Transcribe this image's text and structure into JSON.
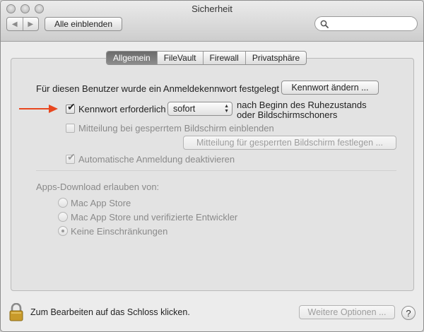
{
  "window": {
    "title": "Sicherheit"
  },
  "toolbar": {
    "back_glyph": "◀",
    "forward_glyph": "▶",
    "show_all_label": "Alle einblenden",
    "search": {
      "value": "",
      "placeholder": ""
    }
  },
  "tabs": [
    {
      "label": "Allgemein",
      "active": true
    },
    {
      "label": "FileVault",
      "active": false
    },
    {
      "label": "Firewall",
      "active": false
    },
    {
      "label": "Privatsphäre",
      "active": false
    }
  ],
  "general": {
    "password_info": "Für diesen Benutzer wurde ein Anmeldekennwort festgelegt",
    "change_password_button": "Kennwort ändern ...",
    "require_password": {
      "label": "Kennwort erforderlich",
      "checked": true
    },
    "require_delay_select": "sofort",
    "require_after_line1": "nach Beginn des Ruhezustands",
    "require_after_line2": "oder Bildschirmschoners",
    "lock_message": {
      "label": "Mitteilung bei gesperrtem Bildschirm einblenden",
      "checked": false,
      "enabled": false
    },
    "set_lock_message_button": "Mitteilung für gesperrten Bildschirm festlegen ...",
    "disable_auto_login": {
      "label": "Automatische Anmeldung deaktivieren",
      "checked": true,
      "enabled": false
    },
    "apps_download_label": "Apps-Download erlauben von:",
    "download_options": [
      {
        "label": "Mac App Store",
        "selected": false
      },
      {
        "label": "Mac App Store und verifizierte Entwickler",
        "selected": false
      },
      {
        "label": "Keine Einschränkungen",
        "selected": true
      }
    ]
  },
  "footer": {
    "lock_text": "Zum Bearbeiten auf das Schloss klicken.",
    "more_options_button": "Weitere Optionen ...",
    "help_label": "?"
  },
  "colors": {
    "annotation_arrow": "#e8471f",
    "active_tab": "#777777"
  },
  "icons": [
    "close-icon",
    "minimize-icon",
    "zoom-icon",
    "search-icon",
    "lock-icon",
    "arrow-annotation-icon",
    "checkmark-icon"
  ]
}
